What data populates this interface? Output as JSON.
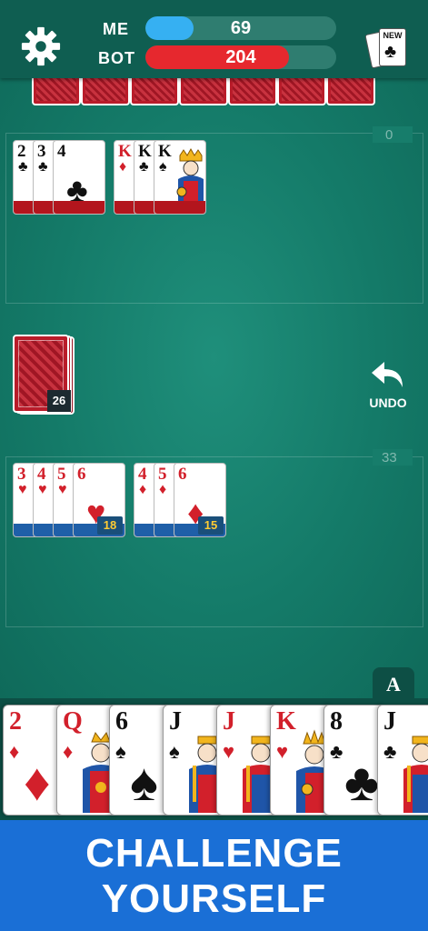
{
  "header": {
    "me_label": "ME",
    "me_score": "69",
    "me_fraction": 0.25,
    "bot_label": "BOT",
    "bot_score": "204",
    "bot_fraction": 0.75,
    "new_label": "NEW",
    "me_color": "#36b0f2",
    "bot_color": "#e6282e"
  },
  "opponent_zone": {
    "score": "0",
    "melds": [
      {
        "cards": [
          {
            "rank": "2",
            "suit": "♣"
          },
          {
            "rank": "3",
            "suit": "♣"
          },
          {
            "rank": "4",
            "suit": "♣"
          }
        ]
      },
      {
        "cards": [
          {
            "rank": "K",
            "suit": "♦"
          },
          {
            "rank": "K",
            "suit": "♣"
          },
          {
            "rank": "K",
            "suit": "♠"
          }
        ]
      }
    ]
  },
  "draw_pile": {
    "count": "26"
  },
  "undo_label": "UNDO",
  "player_zone": {
    "score": "33",
    "melds": [
      {
        "cards": [
          {
            "rank": "3",
            "suit": "♥"
          },
          {
            "rank": "4",
            "suit": "♥"
          },
          {
            "rank": "5",
            "suit": "♥"
          },
          {
            "rank": "6",
            "suit": "♥"
          }
        ],
        "points": "18"
      },
      {
        "cards": [
          {
            "rank": "4",
            "suit": "♦"
          },
          {
            "rank": "5",
            "suit": "♦"
          },
          {
            "rank": "6",
            "suit": "♦"
          }
        ],
        "points": "15"
      }
    ]
  },
  "sort_tab": "A",
  "hand": [
    {
      "rank": "2",
      "suit": "♦"
    },
    {
      "rank": "Q",
      "suit": "♦"
    },
    {
      "rank": "6",
      "suit": "♠"
    },
    {
      "rank": "J",
      "suit": "♠"
    },
    {
      "rank": "J",
      "suit": "♥"
    },
    {
      "rank": "K",
      "suit": "♥"
    },
    {
      "rank": "8",
      "suit": "♣"
    },
    {
      "rank": "J",
      "suit": "♣"
    }
  ],
  "banner": {
    "line1": "CHALLENGE",
    "line2": "YOURSELF"
  }
}
